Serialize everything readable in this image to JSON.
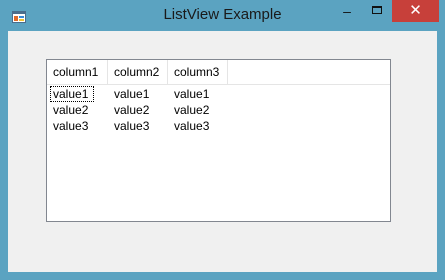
{
  "window": {
    "title": "ListView Example",
    "minimize_glyph": "–",
    "close_glyph": "✕",
    "icons": {
      "app": "app-window-icon",
      "maximize": "maximize-icon"
    },
    "colors": {
      "frame": "#5ba3c1",
      "close": "#c7403a",
      "client": "#f0f0f0"
    }
  },
  "listview": {
    "columns": [
      "column1",
      "column2",
      "column3"
    ],
    "rows": [
      [
        "value1",
        "value1",
        "value1"
      ],
      [
        "value2",
        "value2",
        "value2"
      ],
      [
        "value3",
        "value3",
        "value3"
      ]
    ]
  }
}
